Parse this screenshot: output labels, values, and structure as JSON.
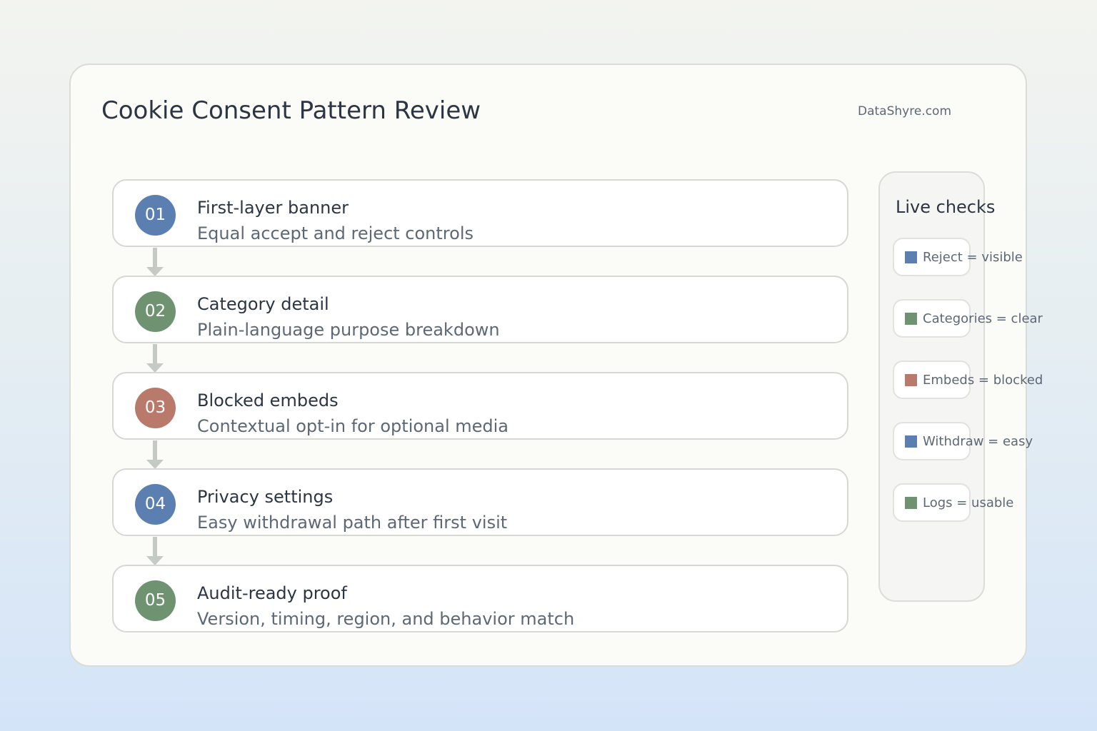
{
  "header": {
    "title": "Cookie Consent Pattern Review",
    "brand": "DataShyre.com"
  },
  "colors": {
    "blue": "#5b7fb1",
    "green": "#6f9370",
    "terracotta": "#b97a6c",
    "connector": "#c5cbc4"
  },
  "steps": [
    {
      "number": "01",
      "title": "First-layer banner",
      "subtitle": "Equal accept and reject controls",
      "color": "#5b7fb1"
    },
    {
      "number": "02",
      "title": "Category detail",
      "subtitle": "Plain-language purpose breakdown",
      "color": "#6f9370"
    },
    {
      "number": "03",
      "title": "Blocked embeds",
      "subtitle": "Contextual opt-in for optional media",
      "color": "#b97a6c"
    },
    {
      "number": "04",
      "title": "Privacy settings",
      "subtitle": "Easy withdrawal path after first visit",
      "color": "#5b7fb1"
    },
    {
      "number": "05",
      "title": "Audit-ready proof",
      "subtitle": "Version, timing, region, and behavior match",
      "color": "#6f9370"
    }
  ],
  "live_checks": {
    "title": "Live checks",
    "items": [
      {
        "label": "Reject = visible",
        "color": "#5b7fb1"
      },
      {
        "label": "Categories = clear",
        "color": "#6f9370"
      },
      {
        "label": "Embeds = blocked",
        "color": "#b97a6c"
      },
      {
        "label": "Withdraw = easy",
        "color": "#5b7fb1"
      },
      {
        "label": "Logs = usable",
        "color": "#6f9370"
      }
    ]
  }
}
